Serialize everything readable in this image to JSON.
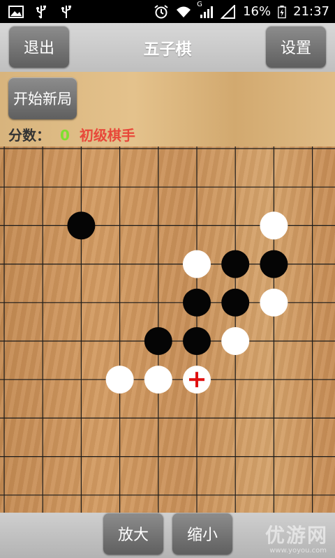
{
  "status_bar": {
    "battery": "16%",
    "time": "21:37",
    "signal_label": "G",
    "icons": [
      "image-icon",
      "usb-icon",
      "usb-icon",
      "alarm-icon",
      "wifi-icon",
      "signal-icon",
      "no-signal-icon",
      "battery-icon"
    ]
  },
  "header": {
    "title": "五子棋",
    "exit_label": "退出",
    "settings_label": "设置"
  },
  "controls": {
    "new_game_label": "开始新局",
    "score_label": "分数：",
    "score_value": "0",
    "rank_label": "初级棋手"
  },
  "footer": {
    "zoom_in_label": "放大",
    "zoom_out_label": "缩小",
    "watermark": "优游网",
    "watermark_url": "www.yoyou.com"
  },
  "colors": {
    "score_value": "#7fe030",
    "rank_label": "#e8483a",
    "last_move_marker": "#e01010"
  },
  "board": {
    "grid_cols_visible": 9,
    "grid_rows_visible": 10,
    "stones": [
      {
        "color": "black",
        "col": 2,
        "row": 2
      },
      {
        "color": "white",
        "col": 7,
        "row": 2
      },
      {
        "color": "white",
        "col": 5,
        "row": 3
      },
      {
        "color": "black",
        "col": 6,
        "row": 3
      },
      {
        "color": "black",
        "col": 7,
        "row": 3
      },
      {
        "color": "black",
        "col": 5,
        "row": 4
      },
      {
        "color": "black",
        "col": 6,
        "row": 4
      },
      {
        "color": "white",
        "col": 7,
        "row": 4
      },
      {
        "color": "black",
        "col": 4,
        "row": 5
      },
      {
        "color": "black",
        "col": 5,
        "row": 5
      },
      {
        "color": "white",
        "col": 6,
        "row": 5
      },
      {
        "color": "white",
        "col": 3,
        "row": 6
      },
      {
        "color": "white",
        "col": 4,
        "row": 6
      },
      {
        "color": "white",
        "col": 5,
        "row": 6,
        "last_move": true
      }
    ]
  }
}
